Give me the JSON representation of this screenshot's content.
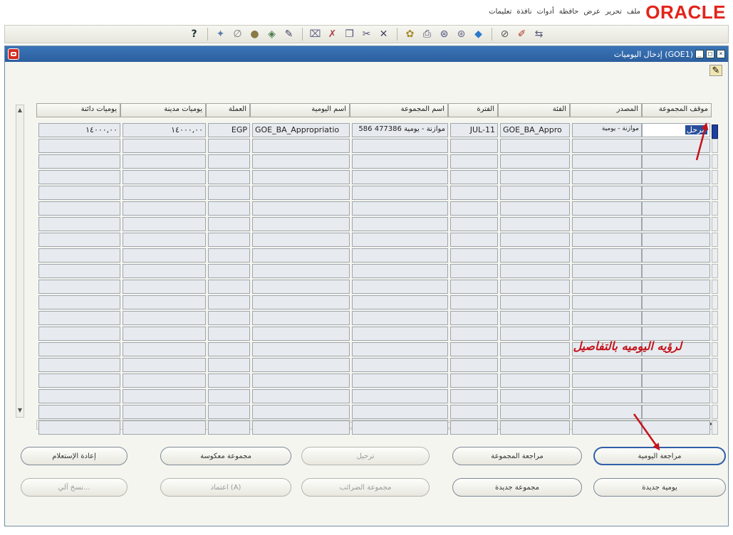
{
  "header": {
    "logo": "ORACLE",
    "menu": [
      "ملف",
      "تحرير",
      "عرض",
      "حافظة",
      "أدوات",
      "نافذة",
      "تعليمات"
    ]
  },
  "toolbar": {
    "icons": [
      "help-icon",
      "flashlight-icon",
      "attachment-icon",
      "folder-icon",
      "edit-icon",
      "translate-icon",
      "clear-icon",
      "delete-icon",
      "new-icon",
      "cut-icon",
      "find-icon",
      "print-icon",
      "navigator-icon",
      "copy-icon",
      "save-icon",
      "stop-icon",
      "refresh-icon",
      "close-form-icon"
    ]
  },
  "window": {
    "title": "إدخال اليوميات (GOE1)"
  },
  "grid": {
    "columns": [
      "موقف المجموعة",
      "المصدر",
      "الفئة",
      "الفترة",
      "اسم المجموعة",
      "اسم اليومية",
      "العملة",
      "يوميات مدينة",
      "يوميات دائنة"
    ],
    "rows": [
      [
        "مرحل",
        "موازنة - يومية",
        "GOE_BA_Appro",
        "JUL-11",
        "موازنة - يومية 477386 586",
        "GOE_BA_Appropriatio",
        "EGP",
        "١٤٠٠٠,٠٠",
        "١٤٠٠٠,٠٠"
      ]
    ],
    "empty_rows": 19
  },
  "buttons": {
    "journal_review": "مراجعة اليومية",
    "batch_review": "مراجعة المجموعة",
    "post": "ترحيل",
    "reverse_batch": "مجموعة معكوسة",
    "reposition": "إعادة الإستعلام",
    "new_journal": "يومية جديدة",
    "new_batch": "مجموعة جديدة",
    "tax_batch": "مجموعة الضرائب",
    "more": "اعتماد (A)",
    "copy": "نسخ آلي..."
  },
  "annotation": {
    "callout": "لرؤيه اليوميه بالتفاصيل",
    "color": "#c5131c"
  }
}
